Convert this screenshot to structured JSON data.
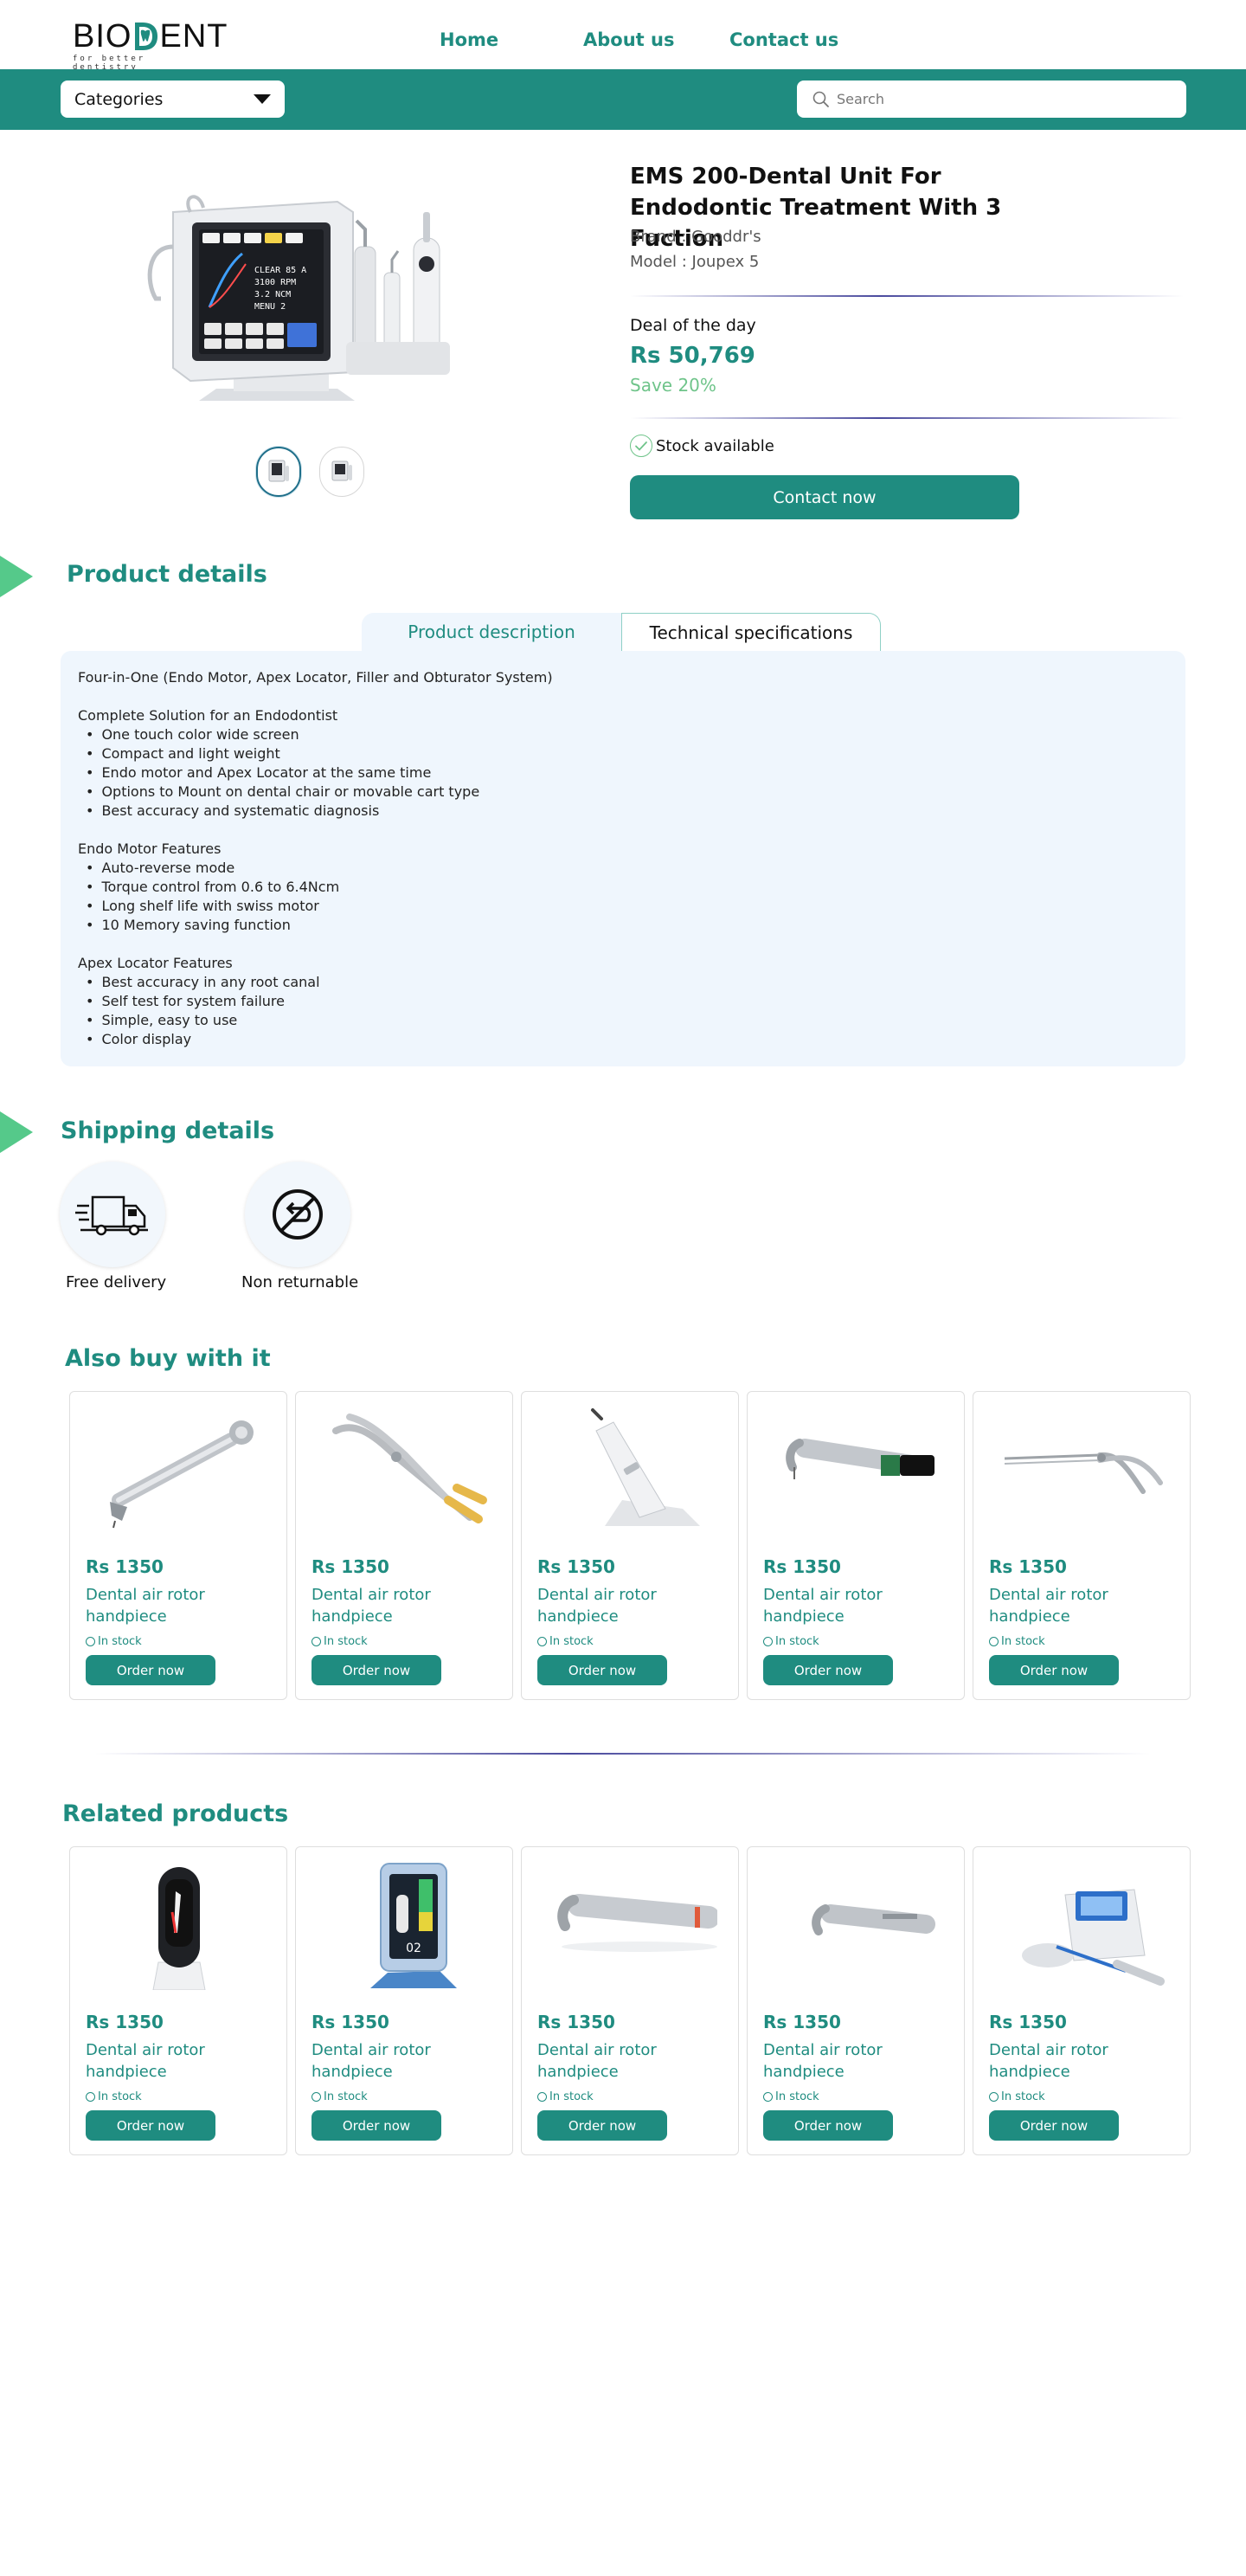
{
  "header": {
    "logo_text": "BIODENT",
    "logo_tagline": "for better dentistry",
    "nav": {
      "home": "Home",
      "about": "About us",
      "contact": "Contact us"
    }
  },
  "catbar": {
    "categories_label": "Categories",
    "search_placeholder": "Search"
  },
  "product": {
    "title": "EMS 200-Dental Unit For Endodontic Treatment With 3 Fuction",
    "brand": "Brand : Gooddr's",
    "model": "Model : Joupex 5",
    "deal_label": "Deal of the day",
    "price": "Rs 50,769",
    "save": "Save 20%",
    "stock": "Stock available",
    "contact_button": "Contact now",
    "screen_readout": [
      "CLEAR 85 A",
      "3100 RPM",
      "3.2 NCM",
      "MENU 2"
    ]
  },
  "product_details": {
    "heading": "Product details",
    "tabs": {
      "description": "Product description",
      "specifications": "Technical specifications"
    },
    "active_tab": "description",
    "intro": "Four-in-One (Endo Motor, Apex Locator, Filler and Obturator System)",
    "groups": [
      {
        "title": "Complete Solution for an Endodontist",
        "items": [
          "One touch color wide screen",
          "Compact and light weight",
          "Endo motor and Apex Locator at the same time",
          "Options to Mount on dental chair or movable cart type",
          "Best accuracy and systematic diagnosis"
        ]
      },
      {
        "title": "Endo Motor Features",
        "items": [
          "Auto-reverse mode",
          "Torque control from 0.6 to 6.4Ncm",
          "Long shelf life with swiss motor",
          "10 Memory saving function"
        ]
      },
      {
        "title": "Apex Locator Features",
        "items": [
          "Best accuracy in any root canal",
          "Self test for system failure",
          "Simple, easy to use",
          "Color display"
        ]
      }
    ]
  },
  "shipping": {
    "heading": "Shipping details",
    "items": [
      {
        "label": "Free delivery",
        "icon": "truck-icon"
      },
      {
        "label": "Non returnable",
        "icon": "no-return-icon"
      }
    ]
  },
  "also_buy": {
    "heading": "Also buy with it",
    "cards": [
      {
        "price": "Rs 1350",
        "name": "Dental air rotor handpiece",
        "stock": "In stock",
        "button": "Order now",
        "image": "air-rotor-handpiece"
      },
      {
        "price": "Rs 1350",
        "name": "Dental air rotor handpiece",
        "stock": "In stock",
        "button": "Order now",
        "image": "extraction-forceps"
      },
      {
        "price": "Rs 1350",
        "name": "Dental air rotor handpiece",
        "stock": "In stock",
        "button": "Order now",
        "image": "curing-light"
      },
      {
        "price": "Rs 1350",
        "name": "Dental air rotor handpiece",
        "stock": "In stock",
        "button": "Order now",
        "image": "contra-angle-handpiece"
      },
      {
        "price": "Rs 1350",
        "name": "Dental air rotor handpiece",
        "stock": "In stock",
        "button": "Order now",
        "image": "rongeur-forceps"
      }
    ]
  },
  "related": {
    "heading": "Related products",
    "cards": [
      {
        "price": "Rs 1350",
        "name": "Dental air rotor handpiece",
        "stock": "In stock",
        "button": "Order now",
        "image": "apex-locator-white"
      },
      {
        "price": "Rs 1350",
        "name": "Dental air rotor handpiece",
        "stock": "In stock",
        "button": "Order now",
        "image": "apex-locator-blue",
        "screen_text": "02"
      },
      {
        "price": "Rs 1350",
        "name": "Dental air rotor handpiece",
        "stock": "In stock",
        "button": "Order now",
        "image": "contra-angle-long"
      },
      {
        "price": "Rs 1350",
        "name": "Dental air rotor handpiece",
        "stock": "In stock",
        "button": "Order now",
        "image": "contra-angle-short"
      },
      {
        "price": "Rs 1350",
        "name": "Dental air rotor handpiece",
        "stock": "In stock",
        "button": "Order now",
        "image": "endo-motor-unit"
      }
    ]
  },
  "colors": {
    "brand_teal": "#1f8c80",
    "accent_green": "#55c98a",
    "save_green": "#6fc48a",
    "panel_bg": "#eff6fd"
  }
}
